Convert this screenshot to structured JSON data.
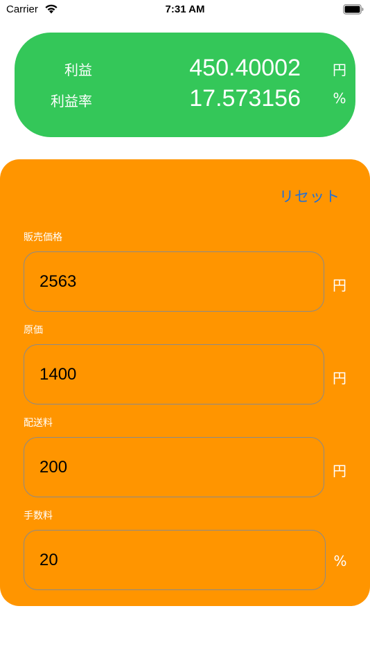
{
  "status_bar": {
    "carrier": "Carrier",
    "time": "7:31 AM"
  },
  "result": {
    "profit_label": "利益",
    "profit_value": "450.40002",
    "profit_unit": "円",
    "margin_label": "利益率",
    "margin_value": "17.573156",
    "margin_unit": "%",
    "background_color": "#34c759"
  },
  "form": {
    "background_color": "#ff9500",
    "reset_label": "リセット",
    "reset_color": "#1f70d8",
    "fields": [
      {
        "label": "販売価格",
        "value": "2563",
        "unit": "円"
      },
      {
        "label": "原価",
        "value": "1400",
        "unit": "円"
      },
      {
        "label": "配送料",
        "value": "200",
        "unit": "円"
      },
      {
        "label": "手数料",
        "value": "20",
        "unit": "%"
      }
    ]
  }
}
